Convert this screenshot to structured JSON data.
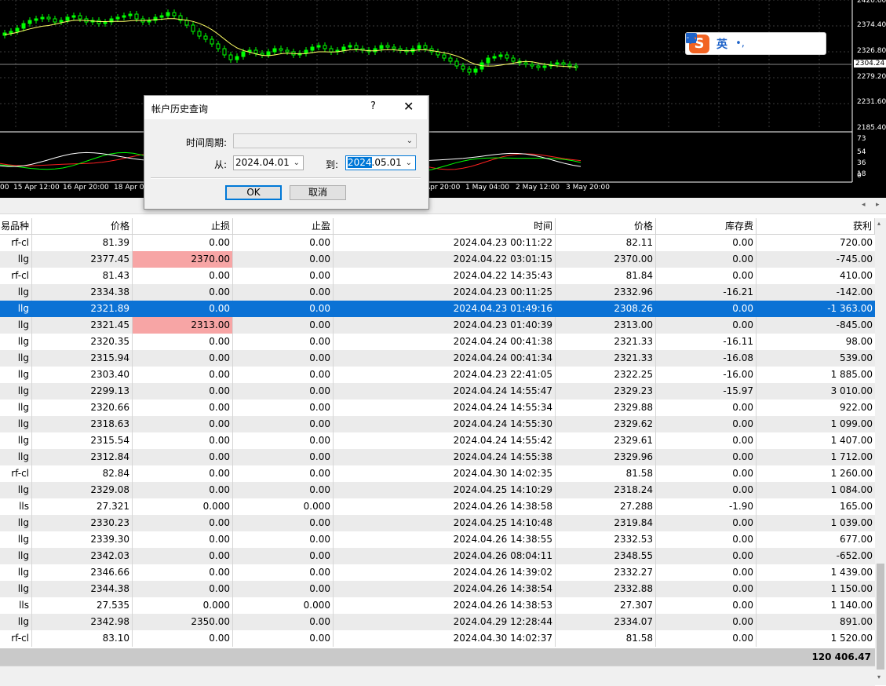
{
  "chart": {
    "price_scale": [
      "2420.60",
      "2374.40",
      "2326.80",
      "2279.20",
      "2231.60",
      "2185.40"
    ],
    "current_price": "2304.24",
    "oscillator_scale": [
      "73",
      "54",
      "36",
      "18"
    ],
    "oscillator_last": "0",
    "time_labels": [
      "00",
      "15 Apr 12:00",
      "16 Apr 20:00",
      "18 Apr 0",
      "Apr 20:00",
      "1 May 04:00",
      "2 May 12:00",
      "3 May 20:00"
    ],
    "colors": {
      "bull": "#00ff00",
      "ma": "#ffff66",
      "grid": "#3c3c3c",
      "osc_red": "#ff2020",
      "osc_green": "#00ff00",
      "osc_white": "#ffffff"
    }
  },
  "ime_toolbar": {
    "logo": "S",
    "mode": "英",
    "icons": [
      "punctuation-icon",
      "microphone-icon",
      "keyboard-icon",
      "skin-icon",
      "toolbox-icon"
    ],
    "punctuation": "•,"
  },
  "dialog": {
    "title": "帐户历史查询",
    "help": "?",
    "close": "✕",
    "period_label": "时间周期:",
    "period_value": "",
    "from_label": "从:",
    "from_value": "2024.04.01",
    "to_label": "到:",
    "to_value_selected": "2024",
    "to_value_rest": ".05.01",
    "ok_label": "OK",
    "cancel_label": "取消"
  },
  "table": {
    "headers": [
      "易品种",
      "价格",
      "止损",
      "止盈",
      "时间",
      "价格",
      "库存费",
      "获利"
    ],
    "rows": [
      [
        "rf-cl",
        "81.39",
        "0.00",
        "0.00",
        "2024.04.23 00:11:22",
        "82.11",
        "0.00",
        "720.00"
      ],
      [
        "llg",
        "2377.45",
        "2370.00",
        "0.00",
        "2024.04.22 03:01:15",
        "2370.00",
        "0.00",
        "-745.00"
      ],
      [
        "rf-cl",
        "81.43",
        "0.00",
        "0.00",
        "2024.04.22 14:35:43",
        "81.84",
        "0.00",
        "410.00"
      ],
      [
        "llg",
        "2334.38",
        "0.00",
        "0.00",
        "2024.04.23 00:11:25",
        "2332.96",
        "-16.21",
        "-142.00"
      ],
      [
        "llg",
        "2321.89",
        "0.00",
        "0.00",
        "2024.04.23 01:49:16",
        "2308.26",
        "0.00",
        "-1 363.00"
      ],
      [
        "llg",
        "2321.45",
        "2313.00",
        "0.00",
        "2024.04.23 01:40:39",
        "2313.00",
        "0.00",
        "-845.00"
      ],
      [
        "llg",
        "2320.35",
        "0.00",
        "0.00",
        "2024.04.24 00:41:38",
        "2321.33",
        "-16.11",
        "98.00"
      ],
      [
        "llg",
        "2315.94",
        "0.00",
        "0.00",
        "2024.04.24 00:41:34",
        "2321.33",
        "-16.08",
        "539.00"
      ],
      [
        "llg",
        "2303.40",
        "0.00",
        "0.00",
        "2024.04.23 22:41:05",
        "2322.25",
        "-16.00",
        "1 885.00"
      ],
      [
        "llg",
        "2299.13",
        "0.00",
        "0.00",
        "2024.04.24 14:55:47",
        "2329.23",
        "-15.97",
        "3 010.00"
      ],
      [
        "llg",
        "2320.66",
        "0.00",
        "0.00",
        "2024.04.24 14:55:34",
        "2329.88",
        "0.00",
        "922.00"
      ],
      [
        "llg",
        "2318.63",
        "0.00",
        "0.00",
        "2024.04.24 14:55:30",
        "2329.62",
        "0.00",
        "1 099.00"
      ],
      [
        "llg",
        "2315.54",
        "0.00",
        "0.00",
        "2024.04.24 14:55:42",
        "2329.61",
        "0.00",
        "1 407.00"
      ],
      [
        "llg",
        "2312.84",
        "0.00",
        "0.00",
        "2024.04.24 14:55:38",
        "2329.96",
        "0.00",
        "1 712.00"
      ],
      [
        "rf-cl",
        "82.84",
        "0.00",
        "0.00",
        "2024.04.30 14:02:35",
        "81.58",
        "0.00",
        "1 260.00"
      ],
      [
        "llg",
        "2329.08",
        "0.00",
        "0.00",
        "2024.04.25 14:10:29",
        "2318.24",
        "0.00",
        "1 084.00"
      ],
      [
        "lls",
        "27.321",
        "0.000",
        "0.000",
        "2024.04.26 14:38:58",
        "27.288",
        "-1.90",
        "165.00"
      ],
      [
        "llg",
        "2330.23",
        "0.00",
        "0.00",
        "2024.04.25 14:10:48",
        "2319.84",
        "0.00",
        "1 039.00"
      ],
      [
        "llg",
        "2339.30",
        "0.00",
        "0.00",
        "2024.04.26 14:38:55",
        "2332.53",
        "0.00",
        "677.00"
      ],
      [
        "llg",
        "2342.03",
        "0.00",
        "0.00",
        "2024.04.26 08:04:11",
        "2348.55",
        "0.00",
        "-652.00"
      ],
      [
        "llg",
        "2346.66",
        "0.00",
        "0.00",
        "2024.04.26 14:39:02",
        "2332.27",
        "0.00",
        "1 439.00"
      ],
      [
        "llg",
        "2344.38",
        "0.00",
        "0.00",
        "2024.04.26 14:38:54",
        "2332.88",
        "0.00",
        "1 150.00"
      ],
      [
        "lls",
        "27.535",
        "0.000",
        "0.000",
        "2024.04.26 14:38:53",
        "27.307",
        "0.00",
        "1 140.00"
      ],
      [
        "llg",
        "2342.98",
        "2350.00",
        "0.00",
        "2024.04.29 12:28:44",
        "2334.07",
        "0.00",
        "891.00"
      ],
      [
        "rf-cl",
        "83.10",
        "0.00",
        "0.00",
        "2024.04.30 14:02:37",
        "81.58",
        "0.00",
        "1 520.00"
      ]
    ],
    "selected_row": 4,
    "stop_loss_hit_rows": [
      1,
      5
    ],
    "total_profit": "120 406.47",
    "colors": {
      "selected": "#0b72d5",
      "stop_loss_hit": "#f7a5a5",
      "odd_row": "#ebebeb"
    }
  },
  "scroll": {
    "left_arrow": "◂",
    "right_arrow": "▸",
    "up_arrow": "▴",
    "down_arrow": "▾"
  }
}
